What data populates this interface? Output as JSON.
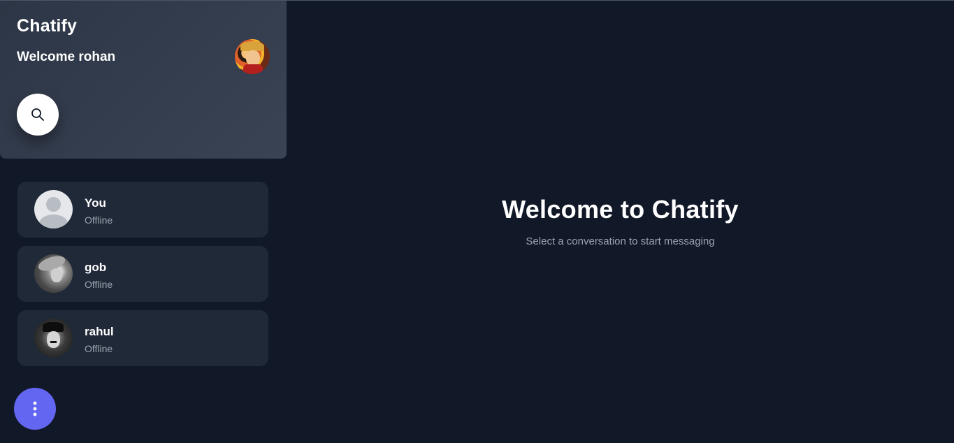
{
  "sidebar": {
    "app_title": "Chatify",
    "welcome": "Welcome rohan",
    "search_icon": "search-icon",
    "contacts": [
      {
        "name": "You",
        "status": "Offline",
        "avatar": "default-user"
      },
      {
        "name": "gob",
        "status": "Offline",
        "avatar": "photo-gob"
      },
      {
        "name": "rahul",
        "status": "Offline",
        "avatar": "photo-rahul"
      }
    ],
    "menu_icon": "more-vertical-icon"
  },
  "main": {
    "title": "Welcome to Chatify",
    "subtitle": "Select a conversation to start messaging"
  },
  "colors": {
    "background": "#111827",
    "card": "#1f2937",
    "accent": "#6366f1",
    "muted_text": "#9ca3af"
  }
}
